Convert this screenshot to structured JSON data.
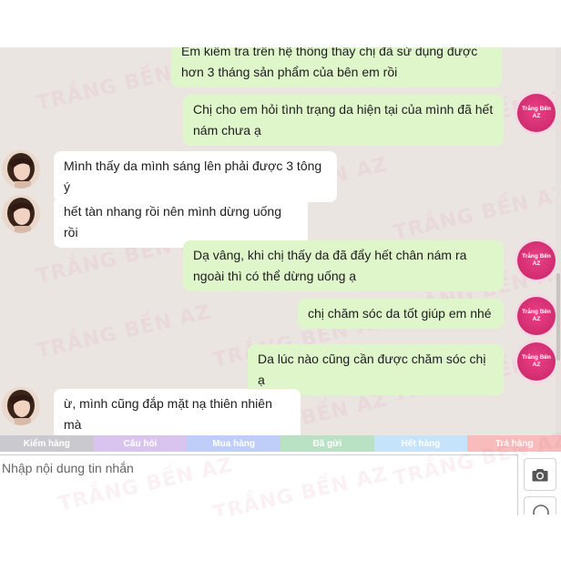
{
  "watermark_text": "TRẮNG BẾN AZ",
  "brand_avatar": {
    "line1": "Trắng Bến",
    "line2": "AZ",
    "color": "#e63a7e"
  },
  "messages": [
    {
      "side": "sent",
      "lines": [
        "Em kiểm tra trên hệ thống thấy chị đã sử dụng được",
        "hơn 3 tháng sản phẩm của bên em rồi"
      ]
    },
    {
      "side": "sent",
      "lines": [
        "Chị cho em hỏi tình trạng da hiện tại của mình đã hết",
        "nám chưa ạ"
      ]
    },
    {
      "side": "recv",
      "lines": [
        "Mình thấy da mình sáng lên phải được 3 tông ý"
      ]
    },
    {
      "side": "recv",
      "lines": [
        "hết tàn nhang rồi nên mình dừng uống rồi"
      ]
    },
    {
      "side": "sent",
      "lines": [
        "Dạ vâng, khi chị thấy da đã đẩy hết chân nám ra",
        "ngoài thì có thể dừng uống ạ"
      ]
    },
    {
      "side": "sent",
      "lines": [
        "chị chăm sóc da tốt giúp em nhé"
      ]
    },
    {
      "side": "sent",
      "lines": [
        "Da lúc nào cũng cần được chăm sóc chị ạ"
      ]
    },
    {
      "side": "recv",
      "lines": [
        "ừ, mình cũng đắp mặt nạ thiên nhiên mà"
      ]
    }
  ],
  "tabs": [
    {
      "label": "Kiểm hàng",
      "color": "#c9c9cf"
    },
    {
      "label": "Câu hỏi",
      "color": "#d9c4ef"
    },
    {
      "label": "Mua hàng",
      "color": "#bfcdf9"
    },
    {
      "label": "Đã gửi",
      "color": "#b9e1c4"
    },
    {
      "label": "Hết hàng",
      "color": "#c5e3fa"
    },
    {
      "label": "Trả hàng",
      "color": "#f8bcbc"
    }
  ],
  "input": {
    "placeholder": "Nhập nội dung tin nhắn"
  },
  "icons": {
    "camera": "camera-icon"
  }
}
